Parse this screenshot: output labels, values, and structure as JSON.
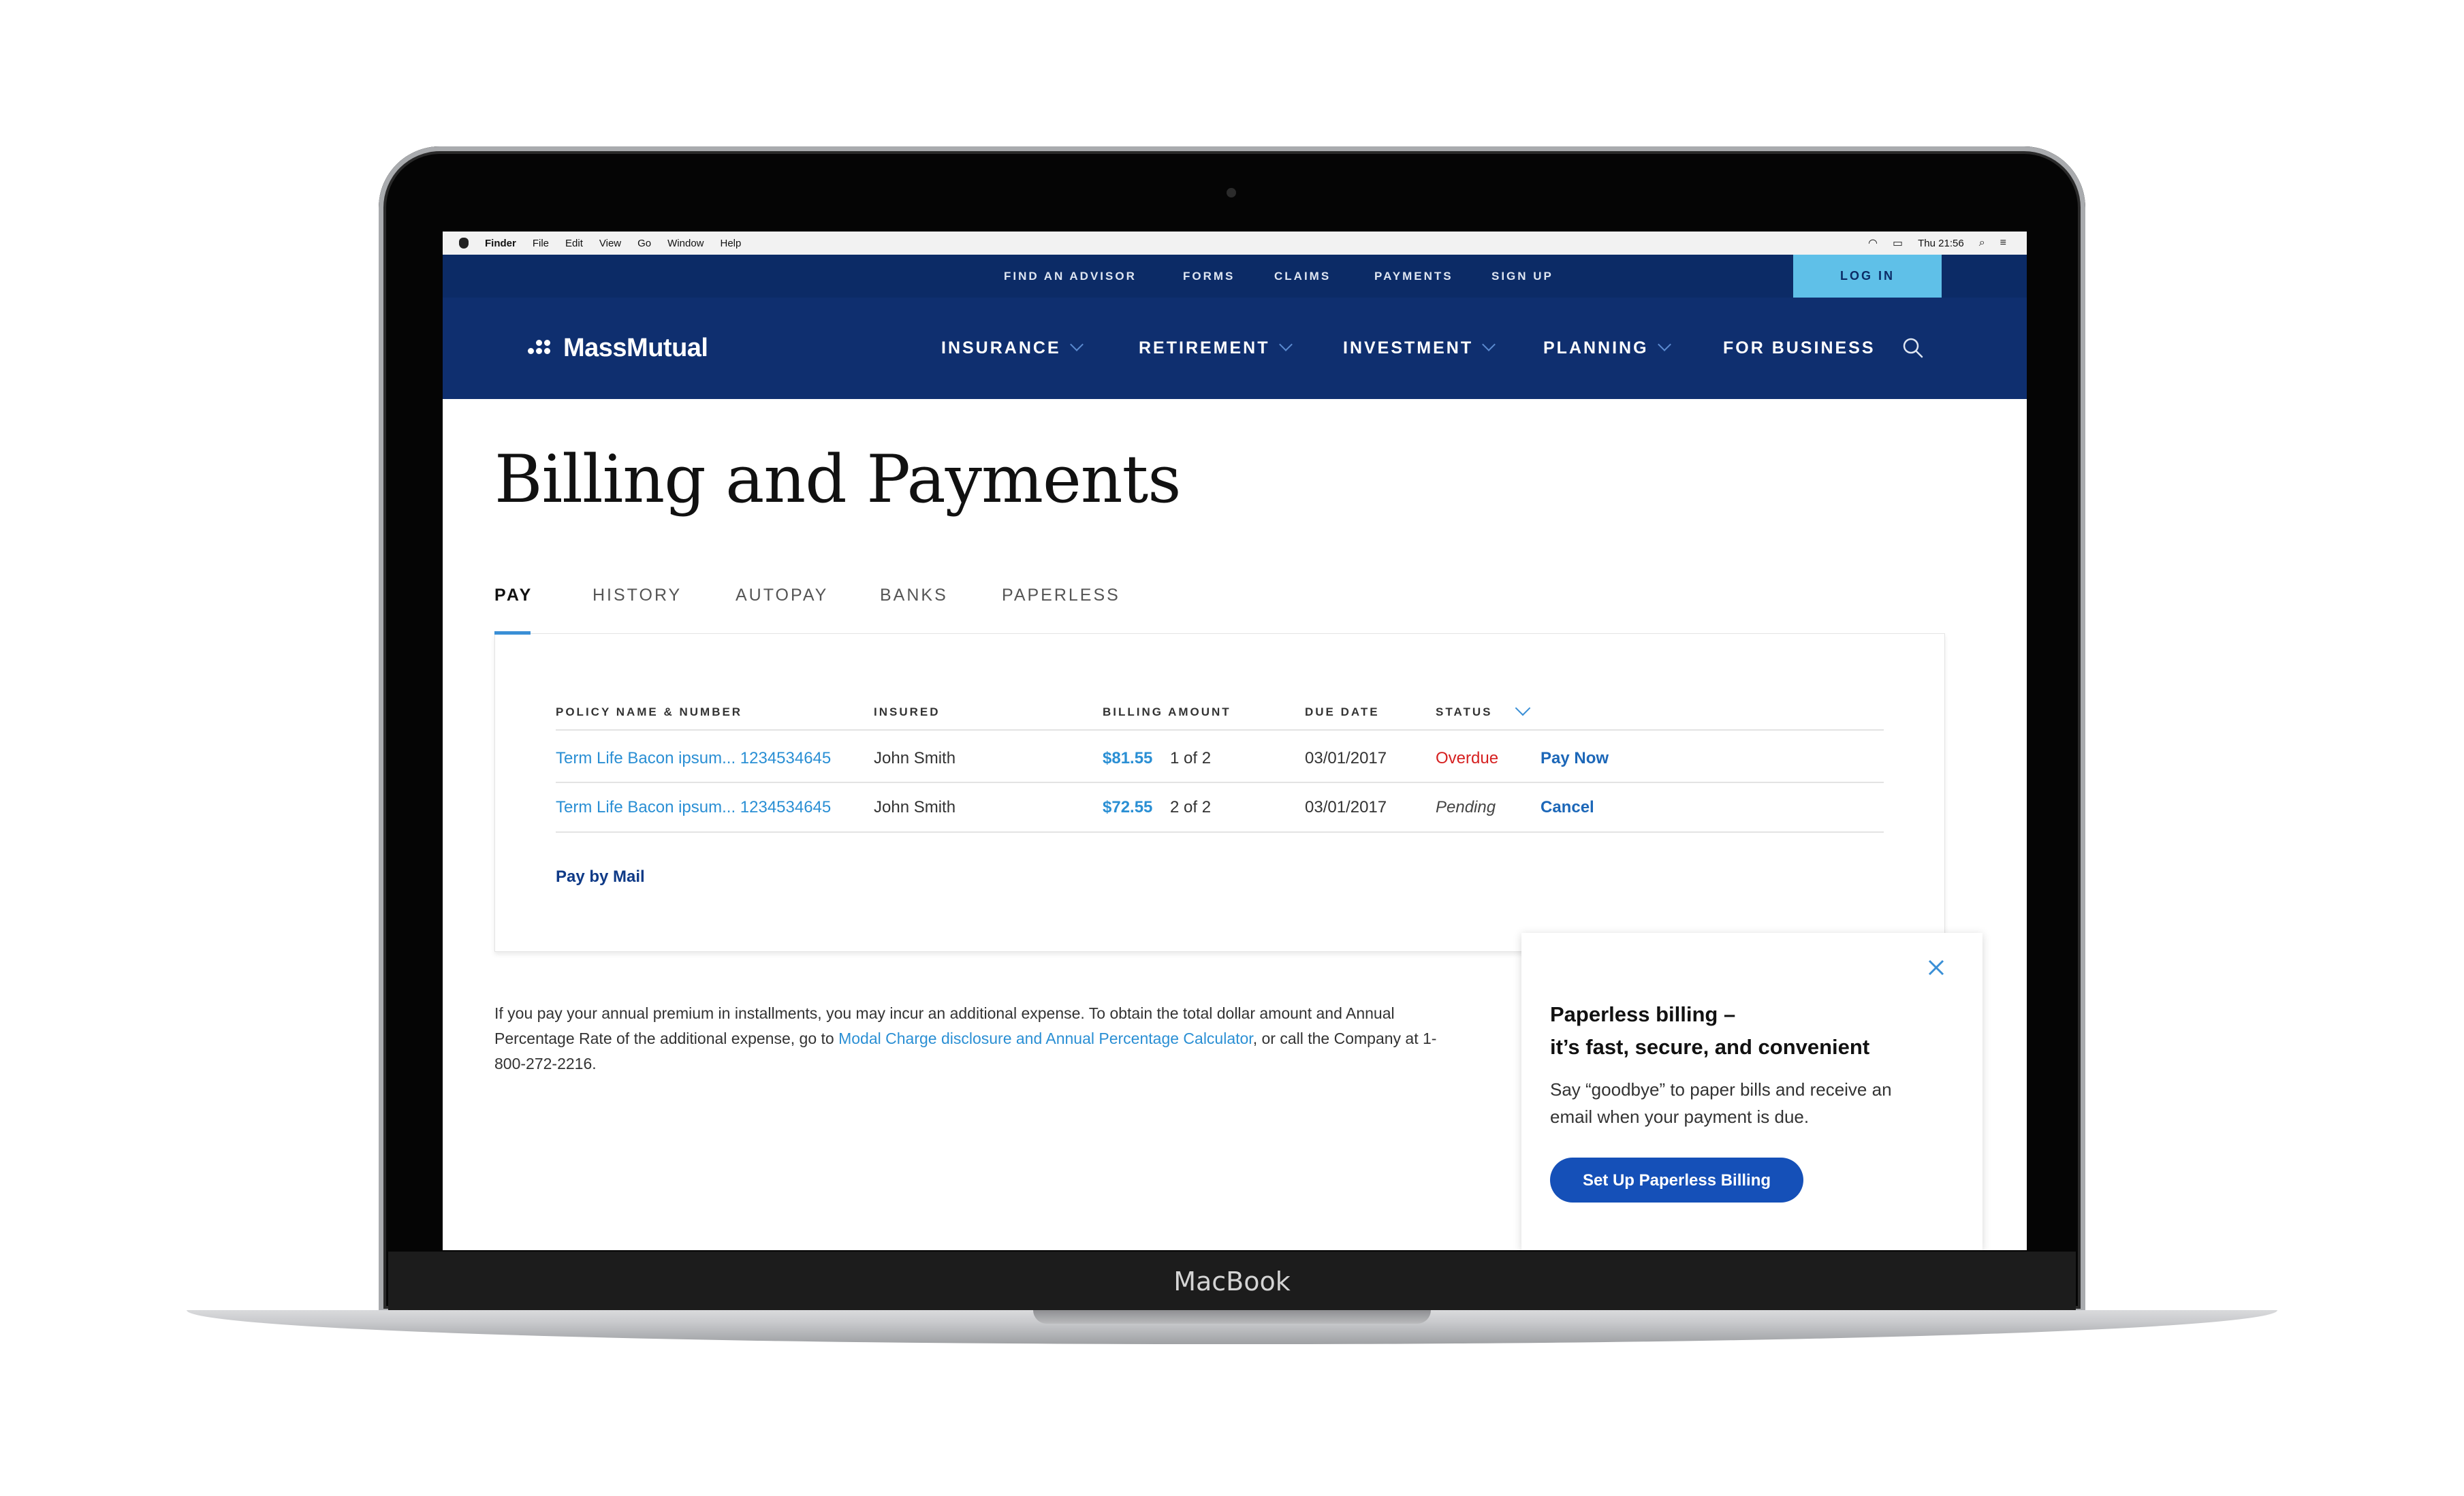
{
  "menubar": {
    "app": "Finder",
    "items": [
      "File",
      "Edit",
      "View",
      "Go",
      "Window",
      "Help"
    ],
    "clock": "Thu 21:56"
  },
  "utility_nav": {
    "links": [
      "FIND AN ADVISOR",
      "FORMS",
      "CLAIMS",
      "PAYMENTS",
      "SIGN UP"
    ],
    "login": "LOG IN"
  },
  "brand": {
    "name": "MassMutual"
  },
  "main_nav": {
    "items": [
      "INSURANCE",
      "RETIREMENT",
      "INVESTMENT",
      "PLANNING",
      "FOR BUSINESS"
    ]
  },
  "page": {
    "title": "Billing and Payments",
    "tabs": [
      "PAY",
      "HISTORY",
      "AUTOPAY",
      "BANKS",
      "PAPERLESS"
    ],
    "active_tab": "PAY"
  },
  "table": {
    "headers": [
      "POLICY NAME & NUMBER",
      "INSURED",
      "BILLING AMOUNT",
      "DUE DATE",
      "STATUS"
    ],
    "rows": [
      {
        "policy": "Term Life Bacon ipsum... 1234534645",
        "insured": "John Smith",
        "amount": "$81.55",
        "installment": "1 of 2",
        "due": "03/01/2017",
        "status": "Overdue",
        "action": "Pay Now"
      },
      {
        "policy": "Term Life Bacon ipsum... 1234534645",
        "insured": "John Smith",
        "amount": "$72.55",
        "installment": "2 of 2",
        "due": "03/01/2017",
        "status": "Pending",
        "action": "Cancel"
      }
    ],
    "pay_by_mail": "Pay by Mail"
  },
  "disclaimer": {
    "before": "If you pay your annual premium in installments, you may incur an additional expense. To obtain the total dollar amount and Annual Percentage Rate of the additional expense, go to ",
    "link": "Modal Charge disclosure and Annual Percentage Calculator",
    "after": ", or call the Company at 1-800-272-2216."
  },
  "promo": {
    "title_line1": "Paperless billing –",
    "title_line2": "it’s fast, secure, and convenient",
    "body": "Say “goodbye” to paper bills and receive an email when your payment is due.",
    "button": "Set Up Paperless Billing"
  },
  "device_label": "MacBook",
  "colors": {
    "nav_dark": "#0f2f6f",
    "utility_bar": "#0c2b66",
    "login_bg": "#5fc0e8",
    "link_blue": "#2a8fd4",
    "overdue_red": "#d62020",
    "button_blue": "#1550b8"
  }
}
